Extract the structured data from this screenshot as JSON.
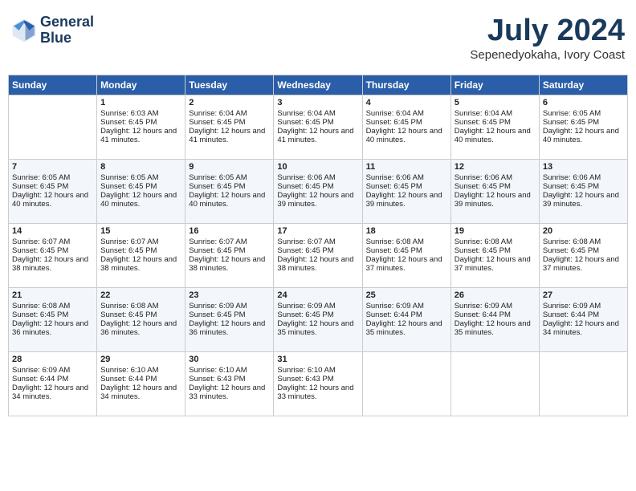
{
  "header": {
    "logo_line1": "General",
    "logo_line2": "Blue",
    "month_year": "July 2024",
    "location": "Sepenedyokaha, Ivory Coast"
  },
  "weekdays": [
    "Sunday",
    "Monday",
    "Tuesday",
    "Wednesday",
    "Thursday",
    "Friday",
    "Saturday"
  ],
  "weeks": [
    [
      {
        "day": "",
        "sunrise": "",
        "sunset": "",
        "daylight": ""
      },
      {
        "day": "1",
        "sunrise": "Sunrise: 6:03 AM",
        "sunset": "Sunset: 6:45 PM",
        "daylight": "Daylight: 12 hours and 41 minutes."
      },
      {
        "day": "2",
        "sunrise": "Sunrise: 6:04 AM",
        "sunset": "Sunset: 6:45 PM",
        "daylight": "Daylight: 12 hours and 41 minutes."
      },
      {
        "day": "3",
        "sunrise": "Sunrise: 6:04 AM",
        "sunset": "Sunset: 6:45 PM",
        "daylight": "Daylight: 12 hours and 41 minutes."
      },
      {
        "day": "4",
        "sunrise": "Sunrise: 6:04 AM",
        "sunset": "Sunset: 6:45 PM",
        "daylight": "Daylight: 12 hours and 40 minutes."
      },
      {
        "day": "5",
        "sunrise": "Sunrise: 6:04 AM",
        "sunset": "Sunset: 6:45 PM",
        "daylight": "Daylight: 12 hours and 40 minutes."
      },
      {
        "day": "6",
        "sunrise": "Sunrise: 6:05 AM",
        "sunset": "Sunset: 6:45 PM",
        "daylight": "Daylight: 12 hours and 40 minutes."
      }
    ],
    [
      {
        "day": "7",
        "sunrise": "Sunrise: 6:05 AM",
        "sunset": "Sunset: 6:45 PM",
        "daylight": "Daylight: 12 hours and 40 minutes."
      },
      {
        "day": "8",
        "sunrise": "Sunrise: 6:05 AM",
        "sunset": "Sunset: 6:45 PM",
        "daylight": "Daylight: 12 hours and 40 minutes."
      },
      {
        "day": "9",
        "sunrise": "Sunrise: 6:05 AM",
        "sunset": "Sunset: 6:45 PM",
        "daylight": "Daylight: 12 hours and 40 minutes."
      },
      {
        "day": "10",
        "sunrise": "Sunrise: 6:06 AM",
        "sunset": "Sunset: 6:45 PM",
        "daylight": "Daylight: 12 hours and 39 minutes."
      },
      {
        "day": "11",
        "sunrise": "Sunrise: 6:06 AM",
        "sunset": "Sunset: 6:45 PM",
        "daylight": "Daylight: 12 hours and 39 minutes."
      },
      {
        "day": "12",
        "sunrise": "Sunrise: 6:06 AM",
        "sunset": "Sunset: 6:45 PM",
        "daylight": "Daylight: 12 hours and 39 minutes."
      },
      {
        "day": "13",
        "sunrise": "Sunrise: 6:06 AM",
        "sunset": "Sunset: 6:45 PM",
        "daylight": "Daylight: 12 hours and 39 minutes."
      }
    ],
    [
      {
        "day": "14",
        "sunrise": "Sunrise: 6:07 AM",
        "sunset": "Sunset: 6:45 PM",
        "daylight": "Daylight: 12 hours and 38 minutes."
      },
      {
        "day": "15",
        "sunrise": "Sunrise: 6:07 AM",
        "sunset": "Sunset: 6:45 PM",
        "daylight": "Daylight: 12 hours and 38 minutes."
      },
      {
        "day": "16",
        "sunrise": "Sunrise: 6:07 AM",
        "sunset": "Sunset: 6:45 PM",
        "daylight": "Daylight: 12 hours and 38 minutes."
      },
      {
        "day": "17",
        "sunrise": "Sunrise: 6:07 AM",
        "sunset": "Sunset: 6:45 PM",
        "daylight": "Daylight: 12 hours and 38 minutes."
      },
      {
        "day": "18",
        "sunrise": "Sunrise: 6:08 AM",
        "sunset": "Sunset: 6:45 PM",
        "daylight": "Daylight: 12 hours and 37 minutes."
      },
      {
        "day": "19",
        "sunrise": "Sunrise: 6:08 AM",
        "sunset": "Sunset: 6:45 PM",
        "daylight": "Daylight: 12 hours and 37 minutes."
      },
      {
        "day": "20",
        "sunrise": "Sunrise: 6:08 AM",
        "sunset": "Sunset: 6:45 PM",
        "daylight": "Daylight: 12 hours and 37 minutes."
      }
    ],
    [
      {
        "day": "21",
        "sunrise": "Sunrise: 6:08 AM",
        "sunset": "Sunset: 6:45 PM",
        "daylight": "Daylight: 12 hours and 36 minutes."
      },
      {
        "day": "22",
        "sunrise": "Sunrise: 6:08 AM",
        "sunset": "Sunset: 6:45 PM",
        "daylight": "Daylight: 12 hours and 36 minutes."
      },
      {
        "day": "23",
        "sunrise": "Sunrise: 6:09 AM",
        "sunset": "Sunset: 6:45 PM",
        "daylight": "Daylight: 12 hours and 36 minutes."
      },
      {
        "day": "24",
        "sunrise": "Sunrise: 6:09 AM",
        "sunset": "Sunset: 6:45 PM",
        "daylight": "Daylight: 12 hours and 35 minutes."
      },
      {
        "day": "25",
        "sunrise": "Sunrise: 6:09 AM",
        "sunset": "Sunset: 6:44 PM",
        "daylight": "Daylight: 12 hours and 35 minutes."
      },
      {
        "day": "26",
        "sunrise": "Sunrise: 6:09 AM",
        "sunset": "Sunset: 6:44 PM",
        "daylight": "Daylight: 12 hours and 35 minutes."
      },
      {
        "day": "27",
        "sunrise": "Sunrise: 6:09 AM",
        "sunset": "Sunset: 6:44 PM",
        "daylight": "Daylight: 12 hours and 34 minutes."
      }
    ],
    [
      {
        "day": "28",
        "sunrise": "Sunrise: 6:09 AM",
        "sunset": "Sunset: 6:44 PM",
        "daylight": "Daylight: 12 hours and 34 minutes."
      },
      {
        "day": "29",
        "sunrise": "Sunrise: 6:10 AM",
        "sunset": "Sunset: 6:44 PM",
        "daylight": "Daylight: 12 hours and 34 minutes."
      },
      {
        "day": "30",
        "sunrise": "Sunrise: 6:10 AM",
        "sunset": "Sunset: 6:43 PM",
        "daylight": "Daylight: 12 hours and 33 minutes."
      },
      {
        "day": "31",
        "sunrise": "Sunrise: 6:10 AM",
        "sunset": "Sunset: 6:43 PM",
        "daylight": "Daylight: 12 hours and 33 minutes."
      },
      {
        "day": "",
        "sunrise": "",
        "sunset": "",
        "daylight": ""
      },
      {
        "day": "",
        "sunrise": "",
        "sunset": "",
        "daylight": ""
      },
      {
        "day": "",
        "sunrise": "",
        "sunset": "",
        "daylight": ""
      }
    ]
  ]
}
